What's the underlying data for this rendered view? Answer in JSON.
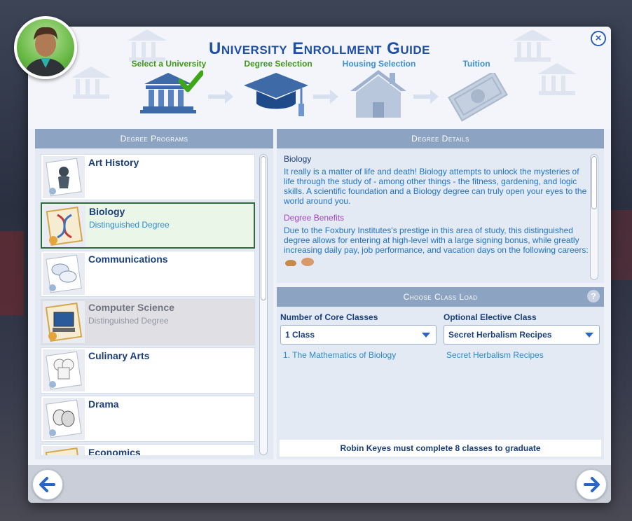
{
  "window": {
    "title": "University Enrollment Guide",
    "close_icon": "×"
  },
  "steps": [
    {
      "label": "Select a University",
      "state": "done"
    },
    {
      "label": "Degree Selection",
      "state": "current"
    },
    {
      "label": "Housing Selection",
      "state": "todo"
    },
    {
      "label": "Tuition",
      "state": "todo"
    }
  ],
  "degree_programs": {
    "header": "Degree Programs",
    "items": [
      {
        "name": "Art History",
        "sub": "",
        "icon": "statue-icon",
        "state": "normal"
      },
      {
        "name": "Biology",
        "sub": "Distinguished Degree",
        "icon": "dna-icon",
        "state": "selected"
      },
      {
        "name": "Communications",
        "sub": "",
        "icon": "speech-bubbles-icon",
        "state": "normal"
      },
      {
        "name": "Computer Science",
        "sub": "Distinguished Degree",
        "icon": "computer-icon",
        "state": "disabled"
      },
      {
        "name": "Culinary Arts",
        "sub": "",
        "icon": "chef-hat-icon",
        "state": "normal"
      },
      {
        "name": "Drama",
        "sub": "",
        "icon": "drama-masks-icon",
        "state": "normal"
      },
      {
        "name": "Economics",
        "sub": "",
        "icon": "economics-icon",
        "state": "normal"
      }
    ]
  },
  "degree_details": {
    "header": "Degree Details",
    "name": "Biology",
    "description": "It really is a matter of life and death! Biology attempts to unlock the mysteries of life through the study of - among other things - the fitness, gardening, and logic skills. A scientific foundation and a Biology degree can truly open your eyes to the world around you.",
    "benefits_heading": "Degree Benefits",
    "benefits_text": "Due to the Foxbury Institutes's prestige in this area of study, this distinguished degree allows for entering at high-level with a large signing bonus, while greatly increasing daily pay, job performance, and vacation days on the following careers:"
  },
  "class_load": {
    "header": "Choose Class Load",
    "help_label": "?",
    "core_label": "Number of Core Classes",
    "core_value": "1 Class",
    "elective_label": "Optional Elective Class",
    "elective_value": "Secret Herbalism Recipes",
    "core_classes": [
      "1.  The Mathematics of Biology"
    ],
    "elective_class": "Secret Herbalism Recipes",
    "graduation_prefix": "Robin Keyes must complete ",
    "graduation_count": "8",
    "graduation_suffix": " classes to graduate"
  },
  "colors": {
    "accent": "#1d4fa8",
    "done_step": "#3e9a18",
    "todo_step": "#3d8fd8",
    "benefits": "#a23fc5",
    "panel_header": "#8da3c2"
  }
}
